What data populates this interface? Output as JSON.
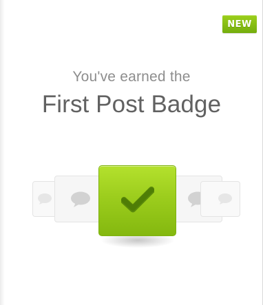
{
  "badge": {
    "new_label": "NEW"
  },
  "heading": {
    "subtitle": "You've earned the",
    "title": "First Post Badge"
  },
  "icons": {
    "center": "checkmark-icon",
    "cards": "speech-bubble-icon"
  },
  "colors": {
    "accent_green": "#9ccd1d",
    "title_gray": "#616161",
    "subtitle_gray": "#8d8d8d",
    "card_gray": "#f6f6f6"
  }
}
